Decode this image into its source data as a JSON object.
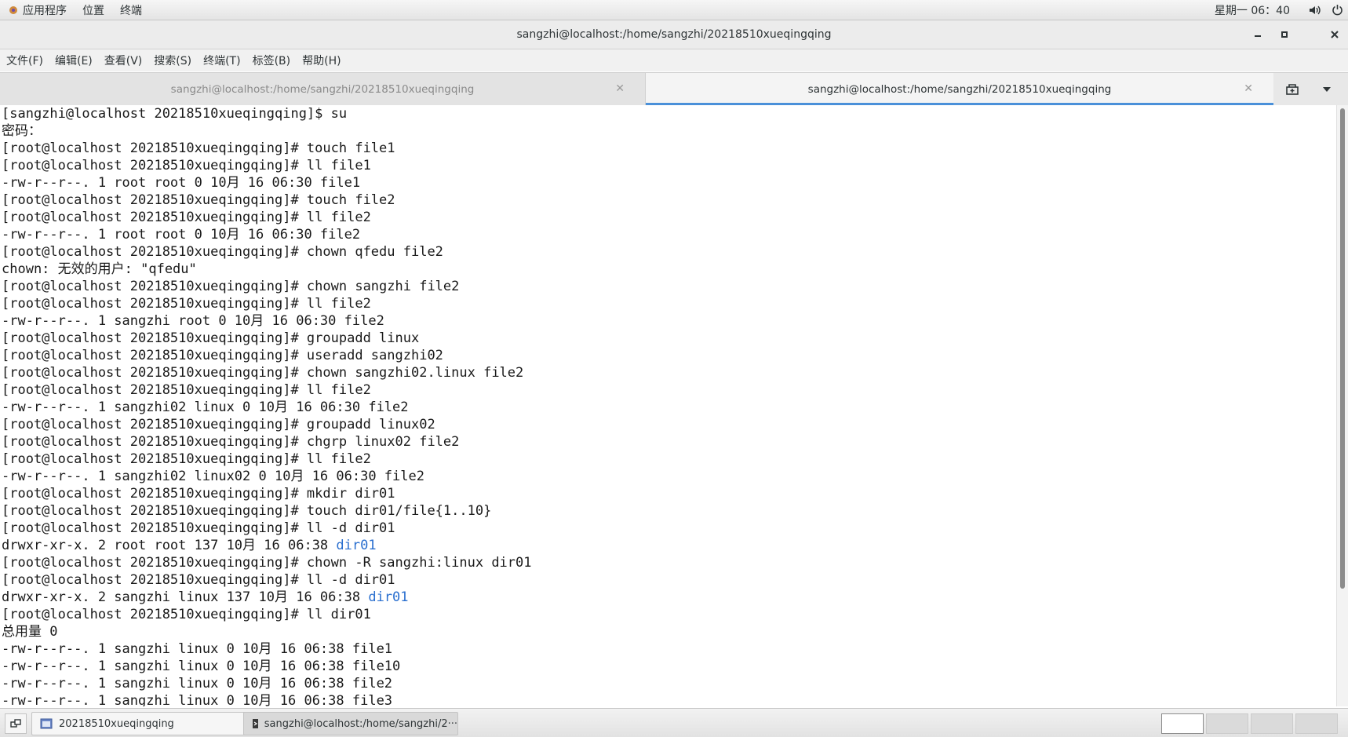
{
  "top_panel": {
    "apps_label": "应用程序",
    "places_label": "位置",
    "terminal_label": "终端",
    "clock": "星期一 06：40",
    "icons": [
      "volume-icon",
      "power-icon"
    ]
  },
  "window": {
    "title": "sangzhi@localhost:/home/sangzhi/20218510xueqingqing",
    "controls": [
      "minimize",
      "maximize",
      "close"
    ]
  },
  "menu": {
    "file": "文件(F)",
    "edit": "编辑(E)",
    "view": "查看(V)",
    "search": "搜索(S)",
    "terminal": "终端(T)",
    "tabs": "标签(B)",
    "help": "帮助(H)"
  },
  "tabs": [
    {
      "label": "sangzhi@localhost:/home/sangzhi/20218510xueqingqing",
      "active": false
    },
    {
      "label": "sangzhi@localhost:/home/sangzhi/20218510xueqingqing",
      "active": true
    }
  ],
  "terminal": {
    "lines": [
      {
        "text": "[sangzhi@localhost 20218510xueqingqing]$ su"
      },
      {
        "text": "密码："
      },
      {
        "text": "[root@localhost 20218510xueqingqing]# touch file1"
      },
      {
        "text": "[root@localhost 20218510xueqingqing]# ll file1"
      },
      {
        "text": "-rw-r--r--. 1 root root 0 10月 16 06:30 file1"
      },
      {
        "text": "[root@localhost 20218510xueqingqing]# touch file2"
      },
      {
        "text": "[root@localhost 20218510xueqingqing]# ll file2"
      },
      {
        "text": "-rw-r--r--. 1 root root 0 10月 16 06:30 file2"
      },
      {
        "text": "[root@localhost 20218510xueqingqing]# chown qfedu file2"
      },
      {
        "text": "chown: 无效的用户: \"qfedu\""
      },
      {
        "text": "[root@localhost 20218510xueqingqing]# chown sangzhi file2"
      },
      {
        "text": "[root@localhost 20218510xueqingqing]# ll file2"
      },
      {
        "text": "-rw-r--r--. 1 sangzhi root 0 10月 16 06:30 file2"
      },
      {
        "text": "[root@localhost 20218510xueqingqing]# groupadd linux"
      },
      {
        "text": "[root@localhost 20218510xueqingqing]# useradd sangzhi02"
      },
      {
        "text": "[root@localhost 20218510xueqingqing]# chown sangzhi02.linux file2"
      },
      {
        "text": "[root@localhost 20218510xueqingqing]# ll file2"
      },
      {
        "text": "-rw-r--r--. 1 sangzhi02 linux 0 10月 16 06:30 file2"
      },
      {
        "text": "[root@localhost 20218510xueqingqing]# groupadd linux02"
      },
      {
        "text": "[root@localhost 20218510xueqingqing]# chgrp linux02 file2"
      },
      {
        "text": "[root@localhost 20218510xueqingqing]# ll file2"
      },
      {
        "text": "-rw-r--r--. 1 sangzhi02 linux02 0 10月 16 06:30 file2"
      },
      {
        "text": "[root@localhost 20218510xueqingqing]# mkdir dir01"
      },
      {
        "text": "[root@localhost 20218510xueqingqing]# touch dir01/file{1..10}"
      },
      {
        "text": "[root@localhost 20218510xueqingqing]# ll -d dir01"
      },
      {
        "text": "drwxr-xr-x. 2 root root 137 10月 16 06:38 ",
        "dir": "dir01"
      },
      {
        "text": "[root@localhost 20218510xueqingqing]# chown -R sangzhi:linux dir01"
      },
      {
        "text": "[root@localhost 20218510xueqingqing]# ll -d dir01"
      },
      {
        "text": "drwxr-xr-x. 2 sangzhi linux 137 10月 16 06:38 ",
        "dir": "dir01"
      },
      {
        "text": "[root@localhost 20218510xueqingqing]# ll dir01"
      },
      {
        "text": "总用量 0"
      },
      {
        "text": "-rw-r--r--. 1 sangzhi linux 0 10月 16 06:38 file1"
      },
      {
        "text": "-rw-r--r--. 1 sangzhi linux 0 10月 16 06:38 file10"
      },
      {
        "text": "-rw-r--r--. 1 sangzhi linux 0 10月 16 06:38 file2"
      },
      {
        "text": "-rw-r--r--. 1 sangzhi linux 0 10月 16 06:38 file3"
      }
    ],
    "dir_color": "#2a6fcf"
  },
  "taskbar": {
    "items": [
      {
        "label": "20218510xueqingqing",
        "icon": "folder-window-icon"
      },
      {
        "label": "sangzhi@localhost:/home/sangzhi/2···",
        "icon": "terminal-window-icon"
      }
    ],
    "workspaces": 4,
    "current_workspace": 1
  },
  "colors": {
    "tab_accent": "#4a90d9",
    "dir_link": "#2a6fcf"
  }
}
